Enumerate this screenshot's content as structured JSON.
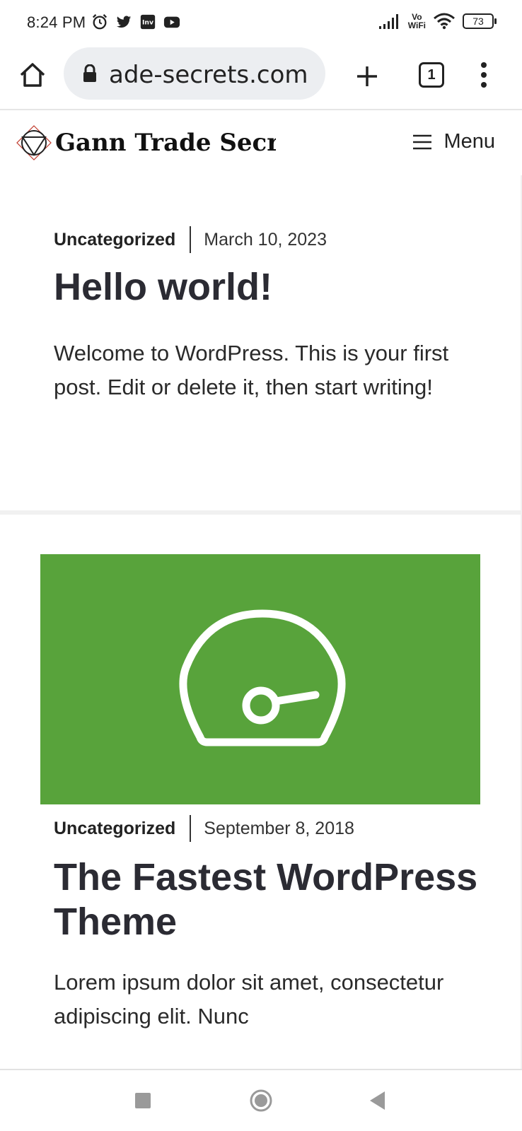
{
  "status_bar": {
    "time": "8:24 PM",
    "notification_icons": [
      "alarm-icon",
      "twitter-icon",
      "investing-icon",
      "youtube-icon"
    ],
    "network_label_top": "Vo",
    "network_label_bottom": "WiFi",
    "battery_level": "73"
  },
  "browser": {
    "url_display": "ade-secrets.com",
    "tab_count": "1"
  },
  "site": {
    "title": "Gann Trade Secrets",
    "menu_label": "Menu"
  },
  "posts": [
    {
      "category": "Uncategorized",
      "date": "March 10, 2023",
      "title": "Hello world!",
      "excerpt": "Welcome to WordPress. This is your first post. Edit or delete it, then start writing!"
    },
    {
      "category": "Uncategorized",
      "date": "September 8, 2018",
      "title": "The Fastest WordPress Theme",
      "excerpt": "Lorem ipsum dolor sit amet, consectetur adipiscing elit. Nunc",
      "featured_image_icon": "speedometer-icon",
      "featured_image_color": "#58a33b"
    }
  ],
  "colors": {
    "title_text": "#2b2b33",
    "featured_green": "#58a33b",
    "url_pill_bg": "#eceef1"
  }
}
